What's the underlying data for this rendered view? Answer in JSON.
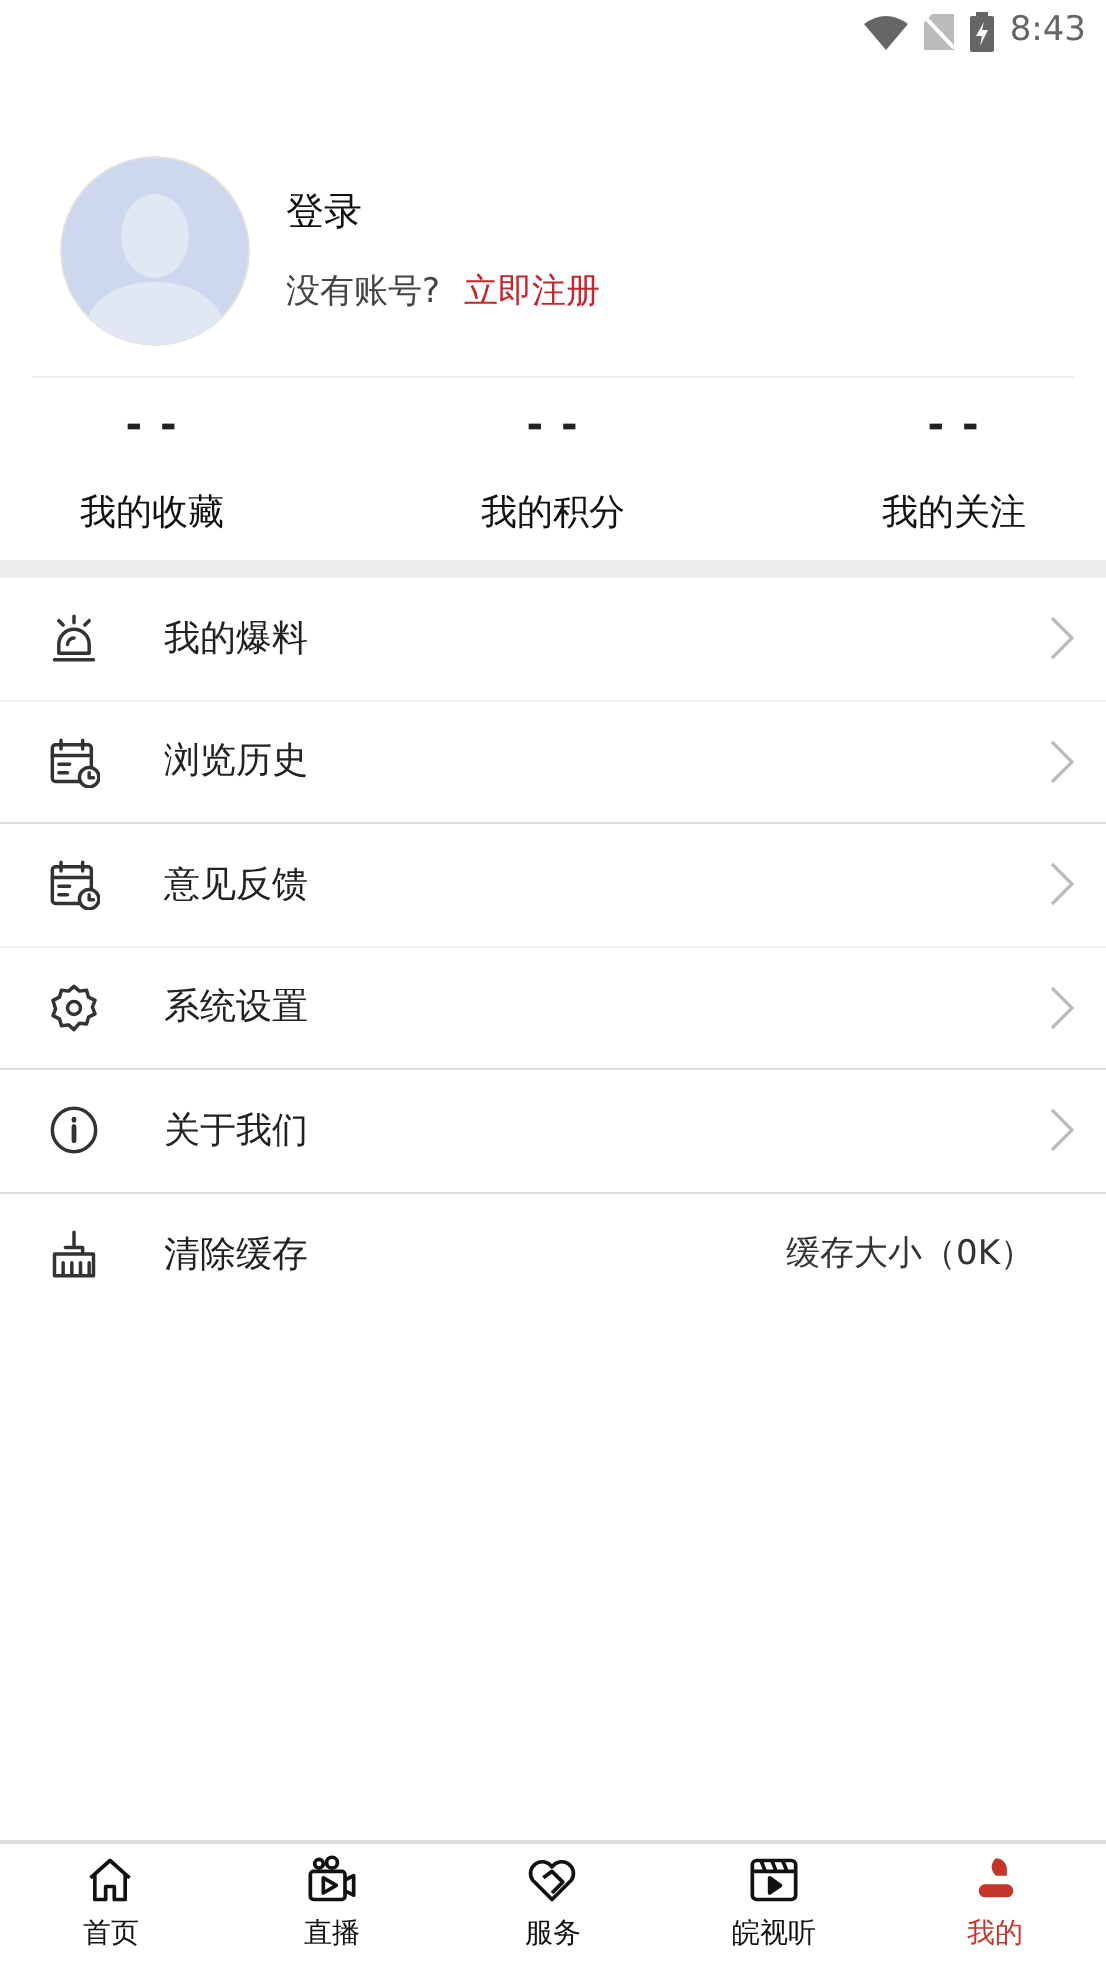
{
  "status_bar": {
    "time": "8:43"
  },
  "profile": {
    "login": "登录",
    "prompt": "没有账号?",
    "register": "立即注册"
  },
  "stats": [
    {
      "value": "- -",
      "label": "我的收藏"
    },
    {
      "value": "- -",
      "label": "我的积分"
    },
    {
      "value": "- -",
      "label": "我的关注"
    }
  ],
  "menu": [
    {
      "kind": "link",
      "label": "我的爆料"
    },
    {
      "kind": "link",
      "label": "浏览历史"
    },
    {
      "kind": "link",
      "label": "意见反馈"
    },
    {
      "kind": "link",
      "label": "系统设置"
    },
    {
      "kind": "link",
      "label": "关于我们"
    },
    {
      "kind": "value",
      "label": "清除缓存",
      "value": "缓存大小（0K）"
    }
  ],
  "tabs": [
    {
      "label": "首页",
      "selected": false
    },
    {
      "label": "直播",
      "selected": false
    },
    {
      "label": "服务",
      "selected": false
    },
    {
      "label": "皖视听",
      "selected": false
    },
    {
      "label": "我的",
      "selected": true
    }
  ]
}
